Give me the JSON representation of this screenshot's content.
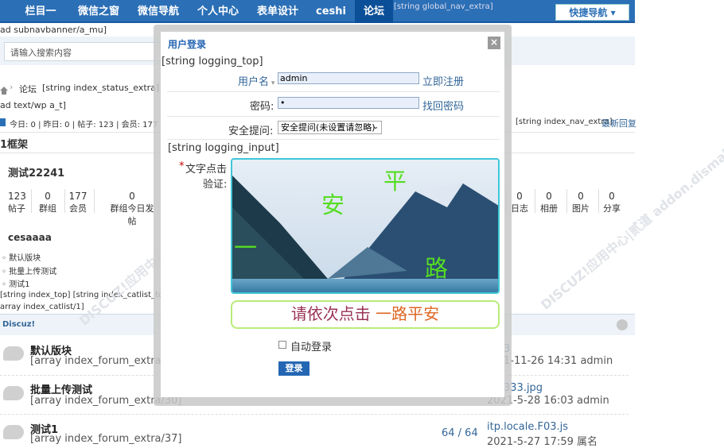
{
  "nav": {
    "items": [
      "栏目一",
      "微信之窗",
      "微信导航",
      "个人中心",
      "表单设计",
      "ceshi",
      "论坛"
    ],
    "extra": "[string global_nav_extra]",
    "quick_nav": "快捷导航 ▾"
  },
  "subnav_text": "ad subnavbanner/a_mu]",
  "search": {
    "placeholder": "请输入搜索内容"
  },
  "breadcrumb": {
    "current": "论坛",
    "extra": "[string index_status_extra]"
  },
  "text_wp": "ad text/wp a_t]",
  "stats_line": "今日: 0 | 昨日: 0 | 帖子: 123 | 会员: 177",
  "nav_extra": "[string index_nav_extra]",
  "latest_reply": "最新回复",
  "frame_title": "1框架",
  "group": {
    "name": "测试22241",
    "stats": [
      {
        "num": "123",
        "label": "帖子"
      },
      {
        "num": "0",
        "label": "群组"
      },
      {
        "num": "177",
        "label": "会员"
      },
      {
        "num": "0",
        "label": "群组今日发帖"
      }
    ],
    "right_stats": [
      {
        "num": "0",
        "label": "日志"
      },
      {
        "num": "0",
        "label": "相册"
      },
      {
        "num": "0",
        "label": "图片"
      },
      {
        "num": "0",
        "label": "分享"
      }
    ]
  },
  "cesaaaa": {
    "title": "cesaaaa",
    "items": [
      "默认版块",
      "批量上传测试",
      "测试1"
    ]
  },
  "index_top": "[string index_top] [string index_catlist_top]",
  "catlist": "array index_catlist/1]",
  "category": "Discuz!",
  "forums": [
    {
      "name": "默认版块",
      "extra": "[array index_forum_extra/2]",
      "right": "3",
      "right2": "1-11-26 14:31 admin"
    },
    {
      "name": "批量上传测试",
      "extra": "[array index_forum_extra/30]",
      "right": "333.jpg",
      "right2": "2021-5-28 16:03 admin"
    },
    {
      "name": "测试1",
      "extra": "[array index_forum_extra/37]",
      "count": "64 / 64",
      "right": "itp.locale.F03.js",
      "right2": "2021-5-27 17:59 属名"
    }
  ],
  "watermark": "DISCUZ!应用中心|贰道 addon.dismall.com",
  "modal": {
    "title": "用户登录",
    "close": "×",
    "logging_top": "[string logging_top]",
    "username_label": "用户名",
    "username_value": "admin",
    "register_link": "立即注册",
    "password_label": "密码:",
    "password_value": "•",
    "find_password": "找回密码",
    "security_label": "安全提问:",
    "security_value": "安全提问(未设置请忽略)",
    "logging_input": "[string logging_input]",
    "captcha_label_star": "*",
    "captcha_label_1": "文字点击",
    "captcha_label_2": "验证:",
    "captcha_chars": [
      "平",
      "安",
      "一",
      "路"
    ],
    "hint_prefix": "请依次点击 ",
    "hint_target": "一路平安",
    "autologin": "自动登录",
    "login_button": "登录"
  },
  "colors": {
    "nav_bg": "#2b6fb6",
    "link": "#336699",
    "captcha_border": "#3ec7d7",
    "captcha_char": "#55dd22",
    "hint_text": "#993355",
    "login_button": "#2466b3"
  }
}
